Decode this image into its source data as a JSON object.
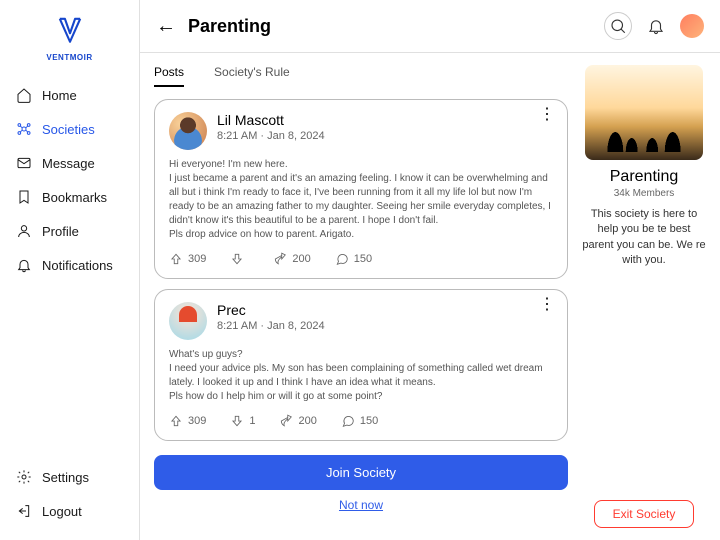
{
  "brand": "VENTMOIR",
  "nav": {
    "home": "Home",
    "societies": "Societies",
    "message": "Message",
    "bookmarks": "Bookmarks",
    "profile": "Profile",
    "notifications": "Notifications",
    "settings": "Settings",
    "logout": "Logout"
  },
  "header": {
    "title": "Parenting"
  },
  "tabs": {
    "posts": "Posts",
    "rule": "Society's Rule"
  },
  "posts": [
    {
      "name": "Lil Mascott",
      "time": "8:21 AM · Jan 8, 2024",
      "body": "Hi everyone! I'm new here.\nI just became a parent and it's an amazing feeling. I know it can be overwhelming and all but i think I'm ready to face it, I've been running from it all my life lol but now I'm ready to be an amazing father to my daughter. Seeing her smile everyday completes, I didn't know it's this beautiful to be a parent. I hope I don't fail.\nPls drop advice on how to parent. Arigato.",
      "up": "309",
      "down": "",
      "share": "200",
      "comment": "150"
    },
    {
      "name": "Prec",
      "time": "8:21 AM · Jan 8, 2024",
      "body": "What's up guys?\nI need your advice pls. My son has been complaining of something called wet dream lately. I looked it up and I think I have an idea what it means.\nPls how do I help him or will it go at some point?",
      "up": "309",
      "down": "1",
      "share": "200",
      "comment": "150"
    }
  ],
  "buttons": {
    "join": "Join Society",
    "notnow": "Not now",
    "exit": "Exit Society"
  },
  "society": {
    "name": "Parenting",
    "members": "34k Members",
    "desc": "This society is here to help you be te best parent you can be. We re with you."
  }
}
